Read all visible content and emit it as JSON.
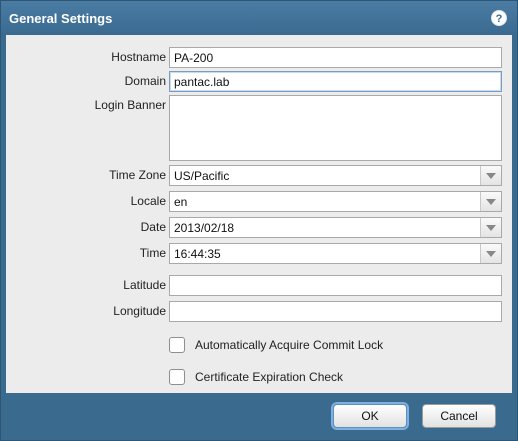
{
  "dialog": {
    "title": "General Settings",
    "help_icon": "?"
  },
  "fields": {
    "hostname": {
      "label": "Hostname",
      "value": "PA-200"
    },
    "domain": {
      "label": "Domain",
      "value": "pantac.lab"
    },
    "login_banner": {
      "label": "Login Banner",
      "value": ""
    },
    "time_zone": {
      "label": "Time Zone",
      "value": "US/Pacific"
    },
    "locale": {
      "label": "Locale",
      "value": "en"
    },
    "date": {
      "label": "Date",
      "value": "2013/02/18"
    },
    "time": {
      "label": "Time",
      "value": "16:44:35"
    },
    "latitude": {
      "label": "Latitude",
      "value": ""
    },
    "longitude": {
      "label": "Longitude",
      "value": ""
    }
  },
  "checkboxes": {
    "commit_lock": {
      "label": "Automatically Acquire Commit Lock",
      "checked": false
    },
    "cert_check": {
      "label": "Certificate Expiration Check",
      "checked": false
    }
  },
  "buttons": {
    "ok": "OK",
    "cancel": "Cancel"
  },
  "colors": {
    "titlebar": "#3b6a8f",
    "body": "#ececec"
  },
  "icons": {
    "help": "help-icon",
    "dropdown": "chevron-down-icon"
  }
}
